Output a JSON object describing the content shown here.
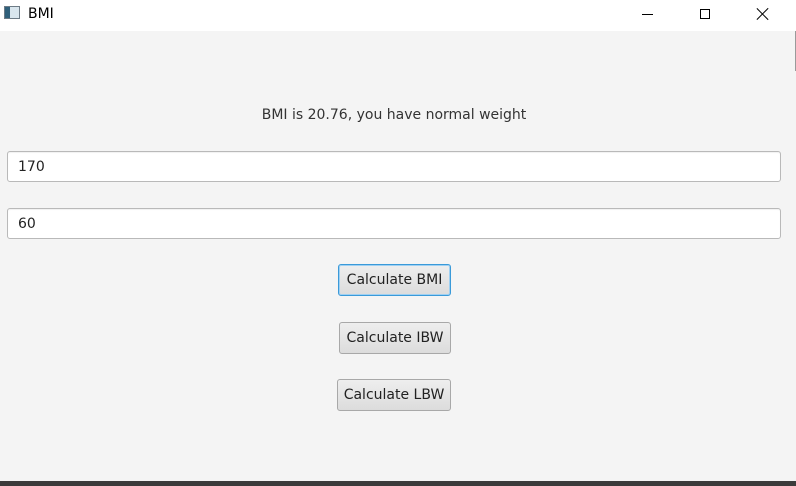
{
  "window": {
    "title": "BMI",
    "icon": "java-app-icon",
    "controls": {
      "minimize_icon": "minimize-icon",
      "maximize_icon": "maximize-icon",
      "close_icon": "close-icon"
    }
  },
  "result": {
    "text": "BMI is 20.76, you have normal weight"
  },
  "inputs": {
    "height": {
      "value": "170"
    },
    "weight": {
      "value": "60"
    }
  },
  "buttons": {
    "calculate_bmi": "Calculate BMI",
    "calculate_ibw": "Calculate IBW",
    "calculate_lbw": "Calculate LBW"
  },
  "colors": {
    "focus_accent": "#3a9ad9",
    "background": "#f4f4f4"
  }
}
